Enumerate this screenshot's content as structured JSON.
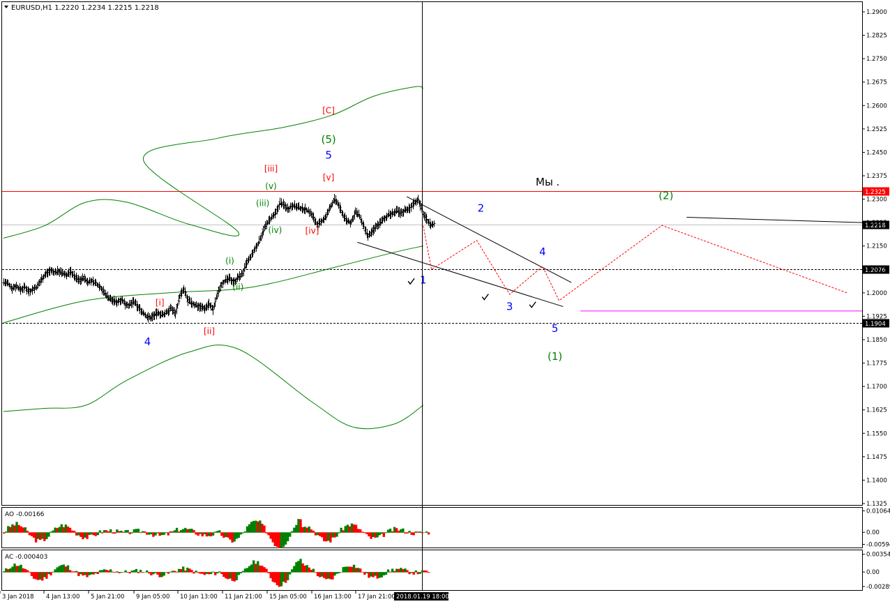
{
  "chart_data": {
    "type": "candlestick",
    "symbol_header": "EURUSD,H1  1.2220 1.2234 1.2215 1.2218",
    "current_time_label": "2018.01.19 18:00",
    "price_axis": {
      "range": [
        1.1325,
        1.2925
      ],
      "ticks": [
        "1.2900",
        "1.2825",
        "1.2750",
        "1.2675",
        "1.2600",
        "1.2525",
        "1.2450",
        "1.2375",
        "1.2300",
        "1.2225",
        "1.2150",
        "1.2075",
        "1.2000",
        "1.1925",
        "1.1850",
        "1.1775",
        "1.1700",
        "1.1625",
        "1.1550",
        "1.1475",
        "1.1400",
        "1.1325"
      ]
    },
    "time_axis": {
      "ticks": [
        "3 Jan 2018",
        "4 Jan 13:00",
        "5 Jan 21:00",
        "9 Jan 05:00",
        "10 Jan 13:00",
        "11 Jan 21:00",
        "15 Jan 05:00",
        "16 Jan 13:00",
        "17 Jan 21:00"
      ]
    },
    "price_levels": [
      {
        "value": 1.2325,
        "label": "1.2325",
        "style": "solid",
        "color": "#ff0000"
      },
      {
        "value": 1.2218,
        "label": "1.2218",
        "style": "solid",
        "color": "#c0c0c0"
      },
      {
        "value": 1.2076,
        "label": "1.2076",
        "style": "dotted",
        "color": "#000000"
      },
      {
        "value": 1.1904,
        "label": "1.1904",
        "style": "dotted",
        "color": "#000000"
      }
    ],
    "magenta_level": 1.1942,
    "text_note": "Мы .",
    "wave_labels": [
      {
        "text": "[C]",
        "color": "#ff0000",
        "t": 79,
        "p": 1.2575
      },
      {
        "text": "(5)",
        "color": "#008000",
        "t": 79,
        "p": 1.248
      },
      {
        "text": "5",
        "color": "#0000ff",
        "t": 79,
        "p": 1.243
      },
      {
        "text": "[iii]",
        "color": "#ff0000",
        "t": 65,
        "p": 1.2388
      },
      {
        "text": "[v]",
        "color": "#ff0000",
        "t": 79,
        "p": 1.236
      },
      {
        "text": "(v)",
        "color": "#008000",
        "t": 65,
        "p": 1.2333
      },
      {
        "text": "(iii)",
        "color": "#008000",
        "t": 63,
        "p": 1.2278
      },
      {
        "text": "(iv)",
        "color": "#008000",
        "t": 66,
        "p": 1.2192
      },
      {
        "text": "[iv]",
        "color": "#ff0000",
        "t": 75,
        "p": 1.219
      },
      {
        "text": "(i)",
        "color": "#008000",
        "t": 55,
        "p": 1.2093
      },
      {
        "text": "(ii)",
        "color": "#008000",
        "t": 57,
        "p": 1.201
      },
      {
        "text": "[i]",
        "color": "#ff0000",
        "t": 38,
        "p": 1.196
      },
      {
        "text": "[ii]",
        "color": "#ff0000",
        "t": 50,
        "p": 1.1868
      },
      {
        "text": "4",
        "color": "#0000ff",
        "t": 35,
        "p": 1.1832
      },
      {
        "text": "1",
        "color": "#0000ff",
        "t": 102,
        "p": 1.203
      },
      {
        "text": "2",
        "color": "#0000ff",
        "t": 116,
        "p": 1.226
      },
      {
        "text": "3",
        "color": "#0000ff",
        "t": 123,
        "p": 1.1945
      },
      {
        "text": "4",
        "color": "#0000ff",
        "t": 131,
        "p": 1.212
      },
      {
        "text": "5",
        "color": "#0000ff",
        "t": 134,
        "p": 1.1875
      },
      {
        "text": "(1)",
        "color": "#008000",
        "t": 134,
        "p": 1.1785
      },
      {
        "text": "(2)",
        "color": "#008000",
        "t": 161,
        "p": 1.23
      }
    ],
    "check_marks": [
      {
        "t": 99,
        "p": 1.2035
      },
      {
        "t": 117,
        "p": 1.1985
      },
      {
        "t": 128.5,
        "p": 1.196
      }
    ],
    "forecast_path": [
      [
        102,
        1.2215
      ],
      [
        104,
        1.2075
      ],
      [
        115,
        1.2168
      ],
      [
        123,
        1.1995
      ],
      [
        131,
        1.2085
      ],
      [
        135,
        1.1975
      ],
      [
        160,
        1.2216
      ],
      [
        205,
        1.2
      ]
    ],
    "channel_lines": [
      {
        "from": [
          98,
          1.2308
        ],
        "to": [
          138,
          1.2033
        ]
      },
      {
        "from": [
          86,
          1.2162
        ],
        "to": [
          136,
          1.1956
        ]
      }
    ],
    "forecast_trend_line": {
      "from": [
        166,
        1.2242
      ],
      "to": [
        205,
        1.2225
      ]
    },
    "bollinger": {
      "upper": [
        [
          34,
          1.2425
        ],
        [
          52,
          1.2495
        ],
        [
          68,
          1.253
        ],
        [
          80,
          1.257
        ],
        [
          90,
          1.263
        ],
        [
          100,
          1.266
        ],
        [
          102,
          1.2655
        ]
      ],
      "middle": [
        [
          0,
          1.1904
        ],
        [
          20,
          1.1975
        ],
        [
          40,
          1.2
        ],
        [
          55,
          1.201
        ],
        [
          65,
          1.203
        ],
        [
          80,
          1.208
        ],
        [
          95,
          1.213
        ],
        [
          102,
          1.215
        ]
      ],
      "lower": [
        [
          0,
          1.172
        ],
        [
          20,
          1.17
        ],
        [
          40,
          1.1695
        ],
        [
          60,
          1.168
        ],
        [
          70,
          1.1625
        ],
        [
          85,
          1.1585
        ],
        [
          95,
          1.1595
        ],
        [
          102,
          1.164
        ]
      ],
      "upper_early": [
        [
          0,
          1.2175
        ],
        [
          10,
          1.2215
        ],
        [
          20,
          1.229
        ],
        [
          30,
          1.229
        ],
        [
          45,
          1.222
        ],
        [
          57,
          1.2195
        ]
      ],
      "lower_early": [
        [
          0,
          1.162
        ],
        [
          10,
          1.163
        ],
        [
          20,
          1.164
        ],
        [
          30,
          1.172
        ],
        [
          45,
          1.181
        ],
        [
          57,
          1.182
        ],
        [
          75,
          1.165
        ],
        [
          85,
          1.157
        ],
        [
          95,
          1.158
        ],
        [
          102,
          1.164
        ]
      ]
    },
    "ohlc_close_path": [
      1.2035,
      1.2028,
      1.2015,
      1.2022,
      1.201,
      1.2018,
      1.2005,
      1.2012,
      1.202,
      1.2045,
      1.206,
      1.2072,
      1.2065,
      1.207,
      1.2062,
      1.2058,
      1.2068,
      1.205,
      1.204,
      1.2048,
      1.2035,
      1.2038,
      1.203,
      1.202,
      1.2,
      1.1985,
      1.1975,
      1.197,
      1.198,
      1.1965,
      1.196,
      1.1972,
      1.1955,
      1.194,
      1.1925,
      1.192,
      1.193,
      1.1935,
      1.1928,
      1.194,
      1.195,
      1.1935,
      1.199,
      1.201,
      1.1975,
      1.1965,
      1.196,
      1.1955,
      1.195,
      1.1965,
      1.1945,
      1.1995,
      1.203,
      1.204,
      1.2045,
      1.2035,
      1.205,
      1.206,
      1.2095,
      1.2115,
      1.214,
      1.2165,
      1.22,
      1.2225,
      1.224,
      1.2255,
      1.229,
      1.228,
      1.227,
      1.2282,
      1.2275,
      1.227,
      1.2268,
      1.226,
      1.224,
      1.2215,
      1.223,
      1.2245,
      1.2275,
      1.23,
      1.228,
      1.225,
      1.223,
      1.2225,
      1.226,
      1.2245,
      1.221,
      1.218,
      1.2195,
      1.2215,
      1.2225,
      1.224,
      1.225,
      1.2255,
      1.2262,
      1.2255,
      1.2268,
      1.227,
      1.229,
      1.23,
      1.226,
      1.2235,
      1.2218
    ],
    "ao": {
      "label": "AO -0.00166",
      "ticks": [
        "0.01064",
        "0.00",
        "-0.00594"
      ],
      "range": [
        -0.0075,
        0.0118
      ]
    },
    "ac": {
      "label": "AC -0.000403",
      "ticks": [
        "0.003547",
        "0.00",
        "-0.00289"
      ],
      "range": [
        -0.0036,
        0.0042
      ]
    }
  }
}
